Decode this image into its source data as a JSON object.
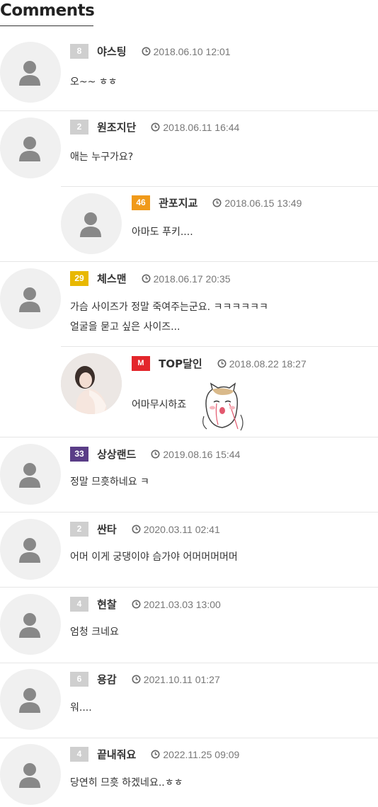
{
  "section": {
    "title": "Comments"
  },
  "comments": [
    {
      "level": "8",
      "nick": "야스팅",
      "time": "2018.06.10 12:01",
      "text": "오~~ ㅎㅎ"
    },
    {
      "level": "2",
      "nick": "원조지단",
      "time": "2018.06.11 16:44",
      "text": "애는 누구가요?"
    },
    {
      "level": "46",
      "nick": "관포지교",
      "time": "2018.06.15 13:49",
      "text": "아마도 푸키...."
    },
    {
      "level": "29",
      "nick": "체스맨",
      "time": "2018.06.17 20:35",
      "text": "가슴 사이즈가 정말 죽여주는군요. ㅋㅋㅋㅋㅋㅋ",
      "text2": "얼굴을 묻고 싶은 사이즈..."
    },
    {
      "level": "M",
      "nick": "TOP달인",
      "time": "2018.08.22 18:27",
      "text": "어마무시하죠"
    },
    {
      "level": "33",
      "nick": "상상랜드",
      "time": "2019.08.16 15:44",
      "text": "정말 므흣하네요 ㅋ"
    },
    {
      "level": "2",
      "nick": "싼타",
      "time": "2020.03.11 02:41",
      "text": "어머 이게 궁댕이야 슴가야 어머머머머머"
    },
    {
      "level": "4",
      "nick": "현찰",
      "time": "2021.03.03 13:00",
      "text": "엄청 크네요"
    },
    {
      "level": "6",
      "nick": "용감",
      "time": "2021.10.11 01:27",
      "text": "워...."
    },
    {
      "level": "4",
      "nick": "끝내줘요",
      "time": "2022.11.25 09:09",
      "text": "당연히 므흣 하겠네요..ㅎㅎ"
    }
  ],
  "colors": {
    "level_gray": "#cfcfcf",
    "level_orange": "#f09a1a",
    "level_yellow": "#e8b800",
    "level_purple": "#5a3d87",
    "level_red": "#e3262b"
  }
}
